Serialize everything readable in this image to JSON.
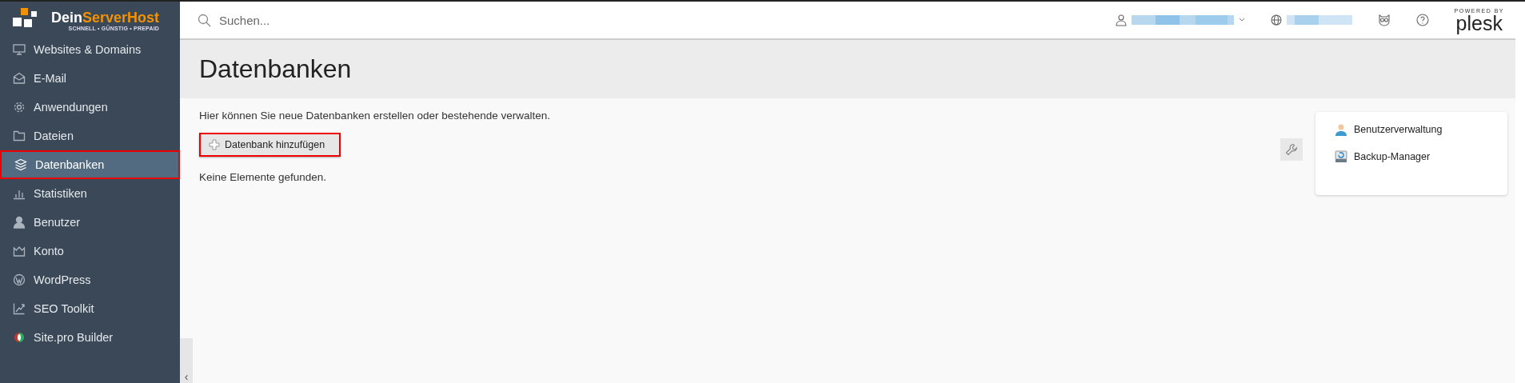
{
  "logo": {
    "name_first": "Dein",
    "name_second": "ServerHost",
    "tagline": "SCHNELL • GÜNSTIG • PREPAID"
  },
  "sidebar": {
    "items": [
      {
        "label": "Websites & Domains",
        "selected": false,
        "highlighted": false
      },
      {
        "label": "E-Mail",
        "selected": false,
        "highlighted": false
      },
      {
        "label": "Anwendungen",
        "selected": false,
        "highlighted": false
      },
      {
        "label": "Dateien",
        "selected": false,
        "highlighted": false
      },
      {
        "label": "Datenbanken",
        "selected": true,
        "highlighted": true
      },
      {
        "label": "Statistiken",
        "selected": false,
        "highlighted": false
      },
      {
        "label": "Benutzer",
        "selected": false,
        "highlighted": false
      },
      {
        "label": "Konto",
        "selected": false,
        "highlighted": false
      },
      {
        "label": "WordPress",
        "selected": false,
        "highlighted": false
      },
      {
        "label": "SEO Toolkit",
        "selected": false,
        "highlighted": false
      },
      {
        "label": "Site.pro Builder",
        "selected": false,
        "highlighted": false
      }
    ],
    "collapse": "‹"
  },
  "header": {
    "search": {
      "placeholder": "Suchen..."
    },
    "powered_by": "POWERED BY",
    "brand": "plesk"
  },
  "page": {
    "title": "Datenbanken",
    "description": "Hier können Sie neue Datenbanken erstellen oder bestehende verwalten.",
    "add_button": {
      "label": "Datenbank hinzufügen",
      "highlighted": true
    },
    "empty_message": "Keine Elemente gefunden."
  },
  "side_panel": {
    "links": [
      {
        "label": "Benutzerverwaltung"
      },
      {
        "label": "Backup-Manager"
      }
    ]
  }
}
